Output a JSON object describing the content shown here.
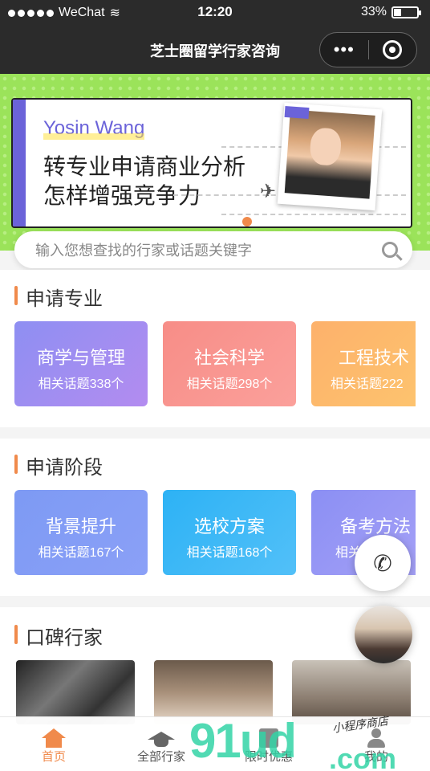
{
  "status_bar": {
    "carrier": "WeChat",
    "time": "12:20",
    "battery": "33%"
  },
  "nav": {
    "title": "芝士圈留学行家咨询",
    "more_label": "•••"
  },
  "banner": {
    "name": "Yosin Wang",
    "line1": "转专业申请商业分析",
    "line2": "怎样增强竞争力"
  },
  "search": {
    "placeholder": "输入您想查找的行家或话题关键字"
  },
  "majors": {
    "title": "申请专业",
    "items": [
      {
        "name": "商学与管理",
        "count": "相关话题338个"
      },
      {
        "name": "社会科学",
        "count": "相关话题298个"
      },
      {
        "name": "工程技术",
        "count": "相关话题222"
      }
    ]
  },
  "stages": {
    "title": "申请阶段",
    "items": [
      {
        "name": "背景提升",
        "count": "相关话题167个"
      },
      {
        "name": "选校方案",
        "count": "相关话题168个"
      },
      {
        "name": "备考方法",
        "count": "相关"
      }
    ]
  },
  "experts": {
    "title": "口碑行家"
  },
  "tabbar": {
    "tabs": [
      {
        "label": "首页",
        "icon": "home-icon"
      },
      {
        "label": "全部行家",
        "icon": "graduation-cap-icon"
      },
      {
        "label": "限时优惠",
        "icon": "gift-icon"
      },
      {
        "label": "我的",
        "icon": "person-icon"
      }
    ]
  },
  "watermark": {
    "main": "91ud",
    "sub": ".com",
    "script": "小程序商店"
  },
  "colors": {
    "accent": "#f08a4b",
    "banner_green": "#9be35a",
    "purple": "#6b63d9"
  }
}
